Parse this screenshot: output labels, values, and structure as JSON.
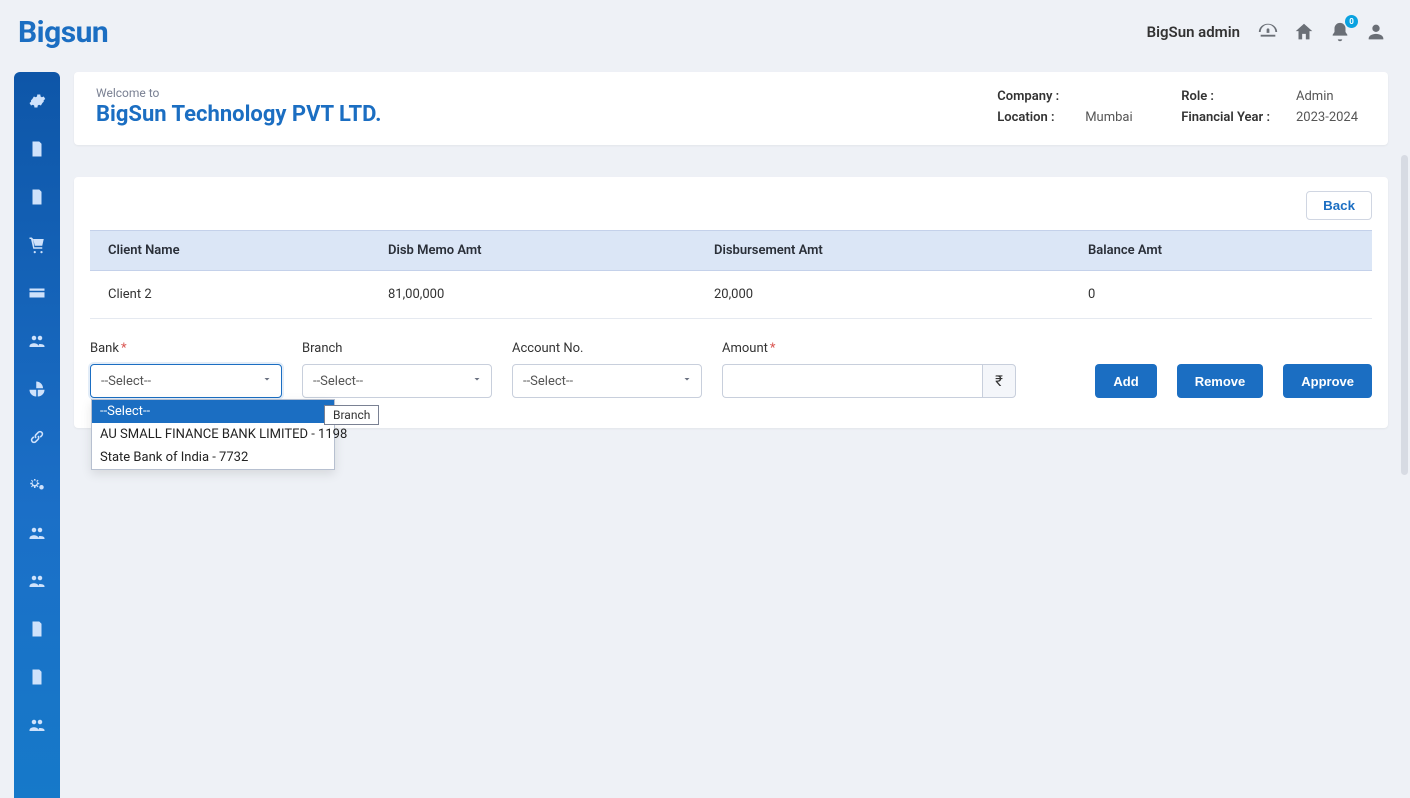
{
  "app": {
    "logo": "Bigsun",
    "user_label": "BigSun admin",
    "notif_count": "0"
  },
  "header": {
    "welcome": "Welcome to",
    "company_name": "BigSun Technology PVT LTD.",
    "company_label": "Company :",
    "company_value": "",
    "location_label": "Location :",
    "location_value": "Mumbai",
    "role_label": "Role :",
    "role_value": "Admin",
    "fy_label": "Financial Year :",
    "fy_value": "2023-2024"
  },
  "buttons": {
    "back": "Back",
    "add": "Add",
    "remove": "Remove",
    "approve": "Approve"
  },
  "table": {
    "headers": {
      "client_name": "Client Name",
      "disb_memo": "Disb Memo Amt",
      "disb_amt": "Disbursement Amt",
      "balance": "Balance Amt"
    },
    "row": {
      "client_name": "Client 2",
      "disb_memo": "81,00,000",
      "disb_amt": "20,000",
      "balance": "0"
    }
  },
  "form": {
    "bank_label": "Bank",
    "branch_label": "Branch",
    "account_label": "Account No.",
    "amount_label": "Amount",
    "select_placeholder": "--Select--",
    "currency_symbol": "₹",
    "bank_options": [
      "--Select--",
      "AU SMALL FINANCE BANK LIMITED - 1198",
      "State Bank of India - 7732"
    ],
    "tooltip": "Branch"
  }
}
